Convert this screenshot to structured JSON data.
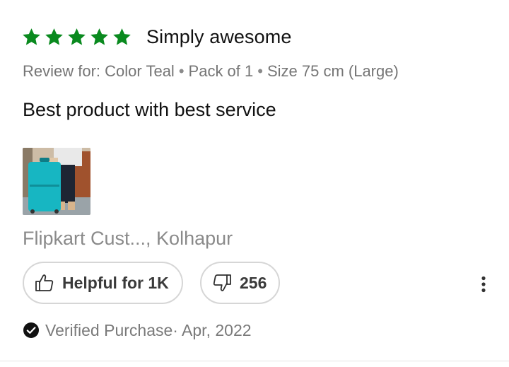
{
  "review": {
    "rating": 5,
    "max_rating": 5,
    "star_color": "#0a8a1f",
    "title": "Simply awesome",
    "variant": {
      "prefix": "Review for:",
      "items": [
        "Color Teal",
        "Pack of 1",
        "Size 75 cm (Large)"
      ],
      "separator": "•"
    },
    "body": "Best product with best service",
    "image": {
      "description": "photo of a teal suitcase"
    },
    "reviewer": "Flipkart Cust..., Kolhapur",
    "helpful": {
      "icon": "thumbs-up-icon",
      "label": "Helpful for 1K"
    },
    "dislike": {
      "icon": "thumbs-down-icon",
      "count": "256"
    },
    "more_icon": "more-vertical-icon",
    "verified": {
      "icon": "check-circle-icon",
      "text": "Verified Purchase· Apr, 2022"
    }
  }
}
